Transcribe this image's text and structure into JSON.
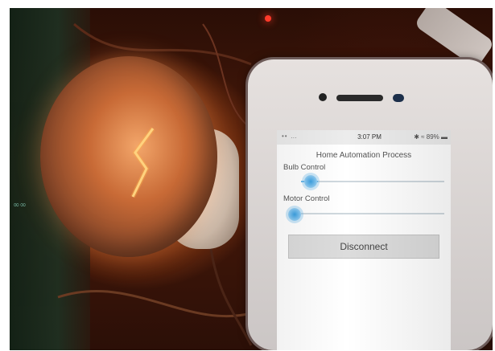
{
  "phone_screen": {
    "status_bar": {
      "time": "3:07 PM",
      "left_indicators": "•• …",
      "right_indicators": "✱ ≈ 89% ▬"
    },
    "app_title": "Home Automation Process",
    "bulb_control": {
      "label": "Bulb Control",
      "level": 0.12
    },
    "motor_control": {
      "label": "Motor Control",
      "level": 0.0
    },
    "disconnect_label": "Disconnect"
  },
  "board": {
    "logo_text": "∞∞"
  },
  "colors": {
    "slider_accent": "#3ca0e0",
    "led_red": "#ff3a2a",
    "led_green": "#7dff5a"
  }
}
